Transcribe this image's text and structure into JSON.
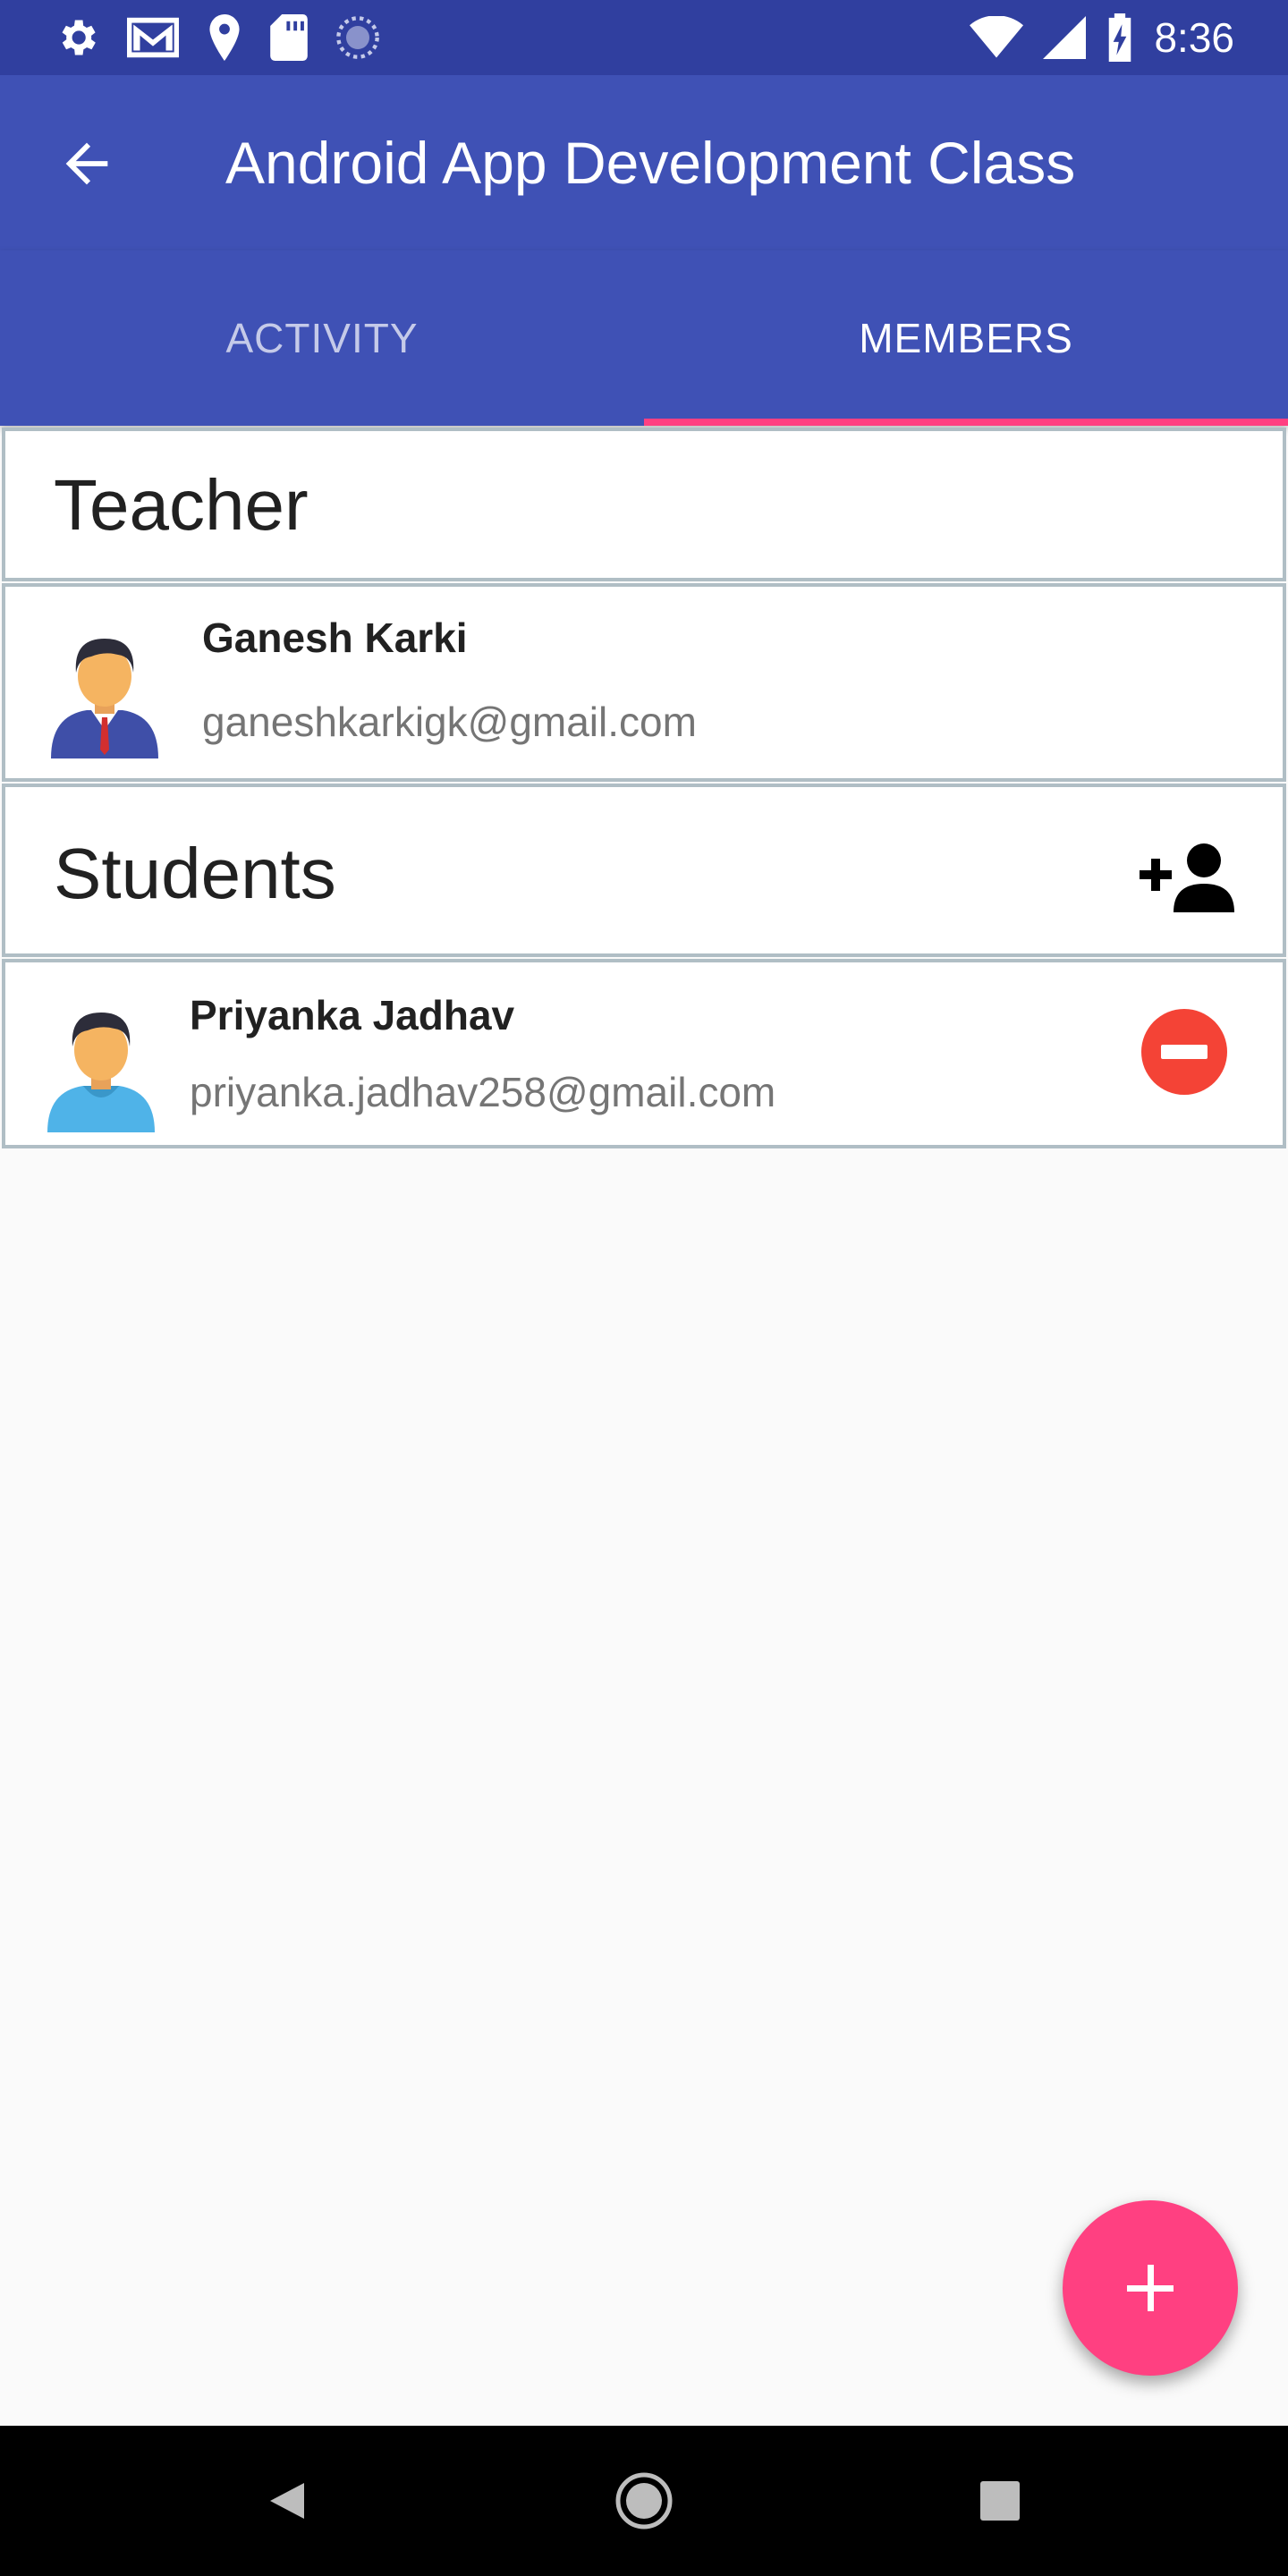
{
  "status_bar": {
    "time": "8:36",
    "icons_left": [
      "settings-icon",
      "gmail-icon",
      "location-icon",
      "sd-card-icon",
      "sync-icon"
    ],
    "icons_right": [
      "wifi-icon",
      "signal-icon",
      "battery-charging-icon"
    ]
  },
  "app_bar": {
    "title": "Android App Development Class",
    "back_icon": "arrow-back-icon"
  },
  "tabs": [
    {
      "label": "ACTIVITY",
      "selected": false
    },
    {
      "label": "MEMBERS",
      "selected": true
    }
  ],
  "teacher_section": {
    "title": "Teacher",
    "members": [
      {
        "name": "Ganesh Karki",
        "email": "ganeshkarkigk@gmail.com",
        "avatar": "teacher-avatar-icon"
      }
    ]
  },
  "students_section": {
    "title": "Students",
    "add_icon": "person-add-icon",
    "members": [
      {
        "name": "Priyanka Jadhav",
        "email": "priyanka.jadhav258@gmail.com",
        "avatar": "student-avatar-icon",
        "action_icon": "remove-circle-icon"
      }
    ]
  },
  "fab": {
    "icon": "add-icon"
  },
  "colors": {
    "primary": "#3f51b5",
    "primary_dark": "#303f9f",
    "accent": "#ff4081",
    "remove": "#f44336"
  },
  "nav_bar": {
    "icons": [
      "nav-back-icon",
      "nav-home-icon",
      "nav-recents-icon"
    ]
  }
}
